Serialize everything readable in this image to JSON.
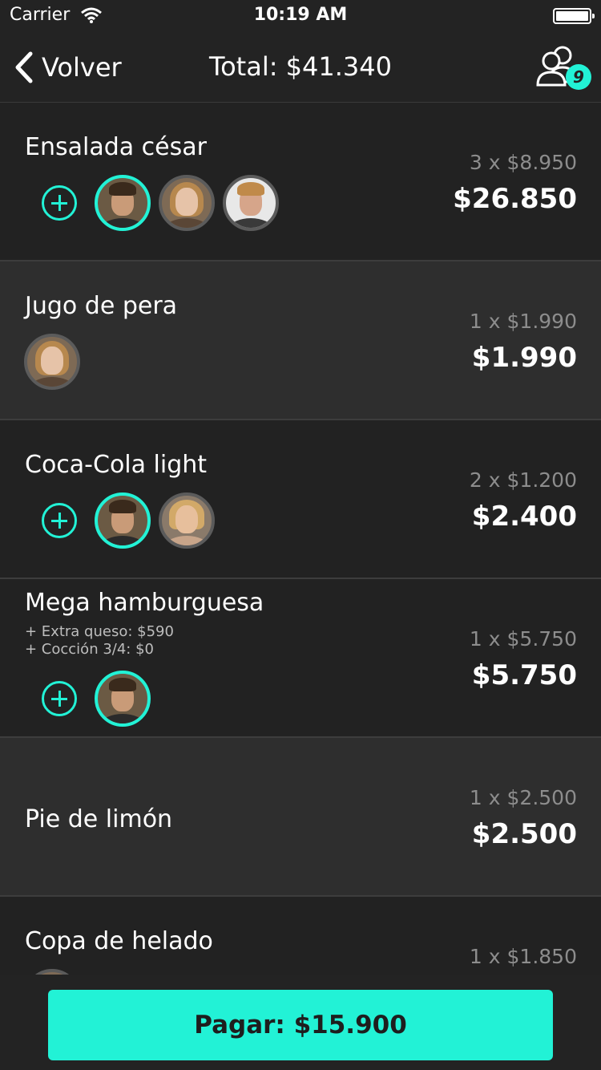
{
  "status_bar": {
    "carrier": "Carrier",
    "time": "10:19 AM"
  },
  "nav": {
    "back_label": "Volver",
    "title": "Total: $41.340",
    "users_count": "9"
  },
  "colors": {
    "accent": "#22f2d6",
    "background": "#232323",
    "row_alt": "#2e2e2e"
  },
  "items": [
    {
      "name": "Ensalada césar",
      "unit": "3 x $8.950",
      "total": "$26.850",
      "modifiers": []
    },
    {
      "name": "Jugo de pera",
      "unit": "1 x $1.990",
      "total": "$1.990",
      "modifiers": []
    },
    {
      "name": "Coca-Cola light",
      "unit": "2 x $1.200",
      "total": "$2.400",
      "modifiers": []
    },
    {
      "name": "Mega hamburguesa",
      "unit": "1 x $5.750",
      "total": "$5.750",
      "modifiers": [
        "+ Extra queso: $590",
        "+ Cocción 3/4: $0"
      ]
    },
    {
      "name": "Pie de limón",
      "unit": "1 x $2.500",
      "total": "$2.500",
      "modifiers": []
    },
    {
      "name": "Copa de helado",
      "unit": "1 x $1.850",
      "total": "",
      "modifiers": []
    }
  ],
  "pay_button": {
    "label": "Pagar: $15.900"
  }
}
